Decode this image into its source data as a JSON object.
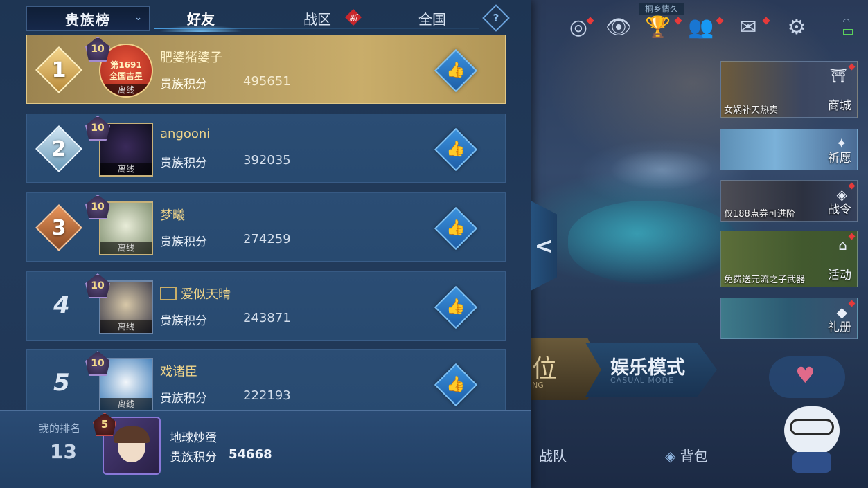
{
  "tabs": {
    "scope_select": "贵族榜",
    "friends": "好友",
    "region": "战区",
    "region_badge": "新",
    "national": "全国",
    "help": "?"
  },
  "leaderboard": {
    "score_label": "贵族积分",
    "status_offline": "离线",
    "rows": [
      {
        "rank": "1",
        "vip": "10",
        "name": "肥婆猪婆子",
        "score": "495651",
        "title_badge_line1": "第1691",
        "title_badge_line2": "全国吉星"
      },
      {
        "rank": "2",
        "vip": "10",
        "name": "angooni",
        "score": "392035"
      },
      {
        "rank": "3",
        "vip": "10",
        "name": "梦曦",
        "score": "274259"
      },
      {
        "rank": "4",
        "vip": "10",
        "name": "爱似天晴",
        "score": "243871"
      },
      {
        "rank": "5",
        "vip": "10",
        "name": "戏诸臣",
        "score": "222193"
      }
    ]
  },
  "my_rank": {
    "label": "我的排名",
    "rank": "13",
    "vip": "5",
    "name": "地球炒蛋",
    "score_label": "贵族积分",
    "score": "54668"
  },
  "top_bar": {
    "location_tag": "桐乡情久"
  },
  "side_menu": [
    {
      "caption": "女娲补天热卖",
      "label": "商城"
    },
    {
      "caption": "",
      "label": "祈愿"
    },
    {
      "caption": "仅188点券可进阶",
      "label": "战令"
    },
    {
      "caption": "免费送元流之子武器",
      "label": "活动"
    },
    {
      "caption": "",
      "label": "礼册"
    }
  ],
  "modes": {
    "rank_char": "位",
    "rank_sub": "NG",
    "casual_title": "娱乐模式",
    "casual_sub": "CASUAL MODE"
  },
  "bottom_nav": {
    "team": "战队",
    "bag": "背包"
  },
  "collapse_arrow": "<",
  "colors": {
    "gold_row": "#b59c62",
    "panel_bg": "#223a5a",
    "accent_blue": "#3a90dc",
    "alert_red": "#e63a3a"
  }
}
